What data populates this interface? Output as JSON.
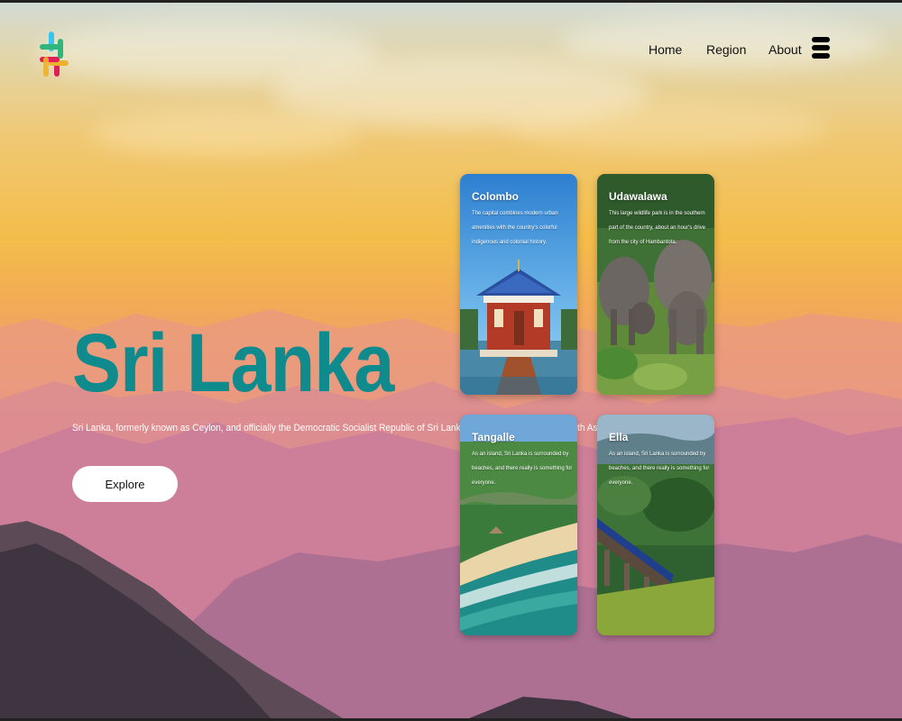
{
  "nav": {
    "logo_icon": "slack-hash-logo-icon",
    "links": [
      {
        "label": "Home"
      },
      {
        "label": "Region"
      },
      {
        "label": "About"
      }
    ],
    "menu_icon": "hamburger-menu-icon"
  },
  "hero": {
    "title": "Sri Lanka",
    "description": "Sri Lanka, formerly known as Ceylon, and officially the Democratic Socialist Republic of Sri Lanka, is an island country in South Asia.",
    "button_label": "Explore",
    "title_color": "#0f8b8d"
  },
  "cards": [
    {
      "title": "Colombo",
      "description": "The capital combines modern urban amenities with the country's colorful indigenous and colonial history.",
      "image": "temple-on-lake"
    },
    {
      "title": "Udawalawa",
      "description": "This large wildlife park is in the southern part of the country, about an hour's drive from the city of Hambantota.",
      "image": "elephants"
    },
    {
      "title": "Tangalle",
      "description": "As an island, Sri Lanka is surrounded by beaches, and there really is something for everyone.",
      "image": "beach-coast"
    },
    {
      "title": "Ella",
      "description": "As an island, Sri Lanka is surrounded by beaches, and there really is something for everyone.",
      "image": "train-on-bridge"
    }
  ]
}
